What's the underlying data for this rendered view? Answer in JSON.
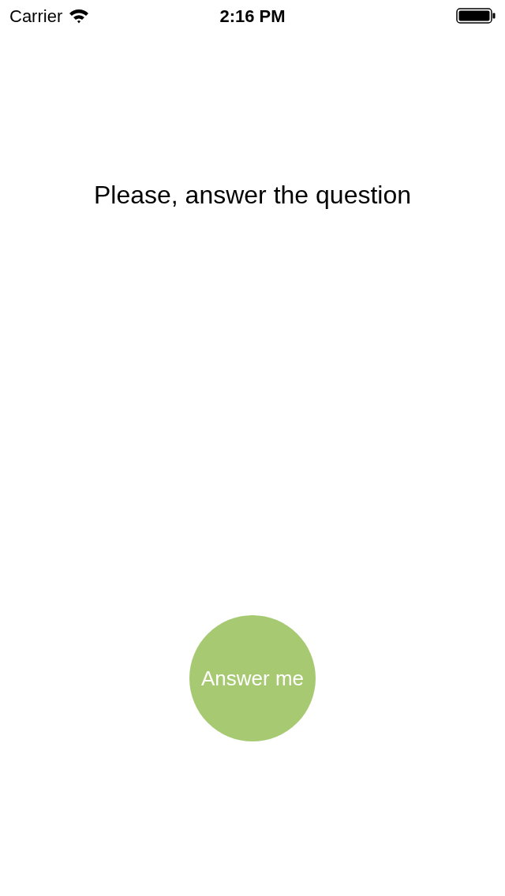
{
  "status_bar": {
    "carrier": "Carrier",
    "time": "2:16 PM"
  },
  "question": "Please, answer the question",
  "answer_button": {
    "label": "Answer me"
  }
}
